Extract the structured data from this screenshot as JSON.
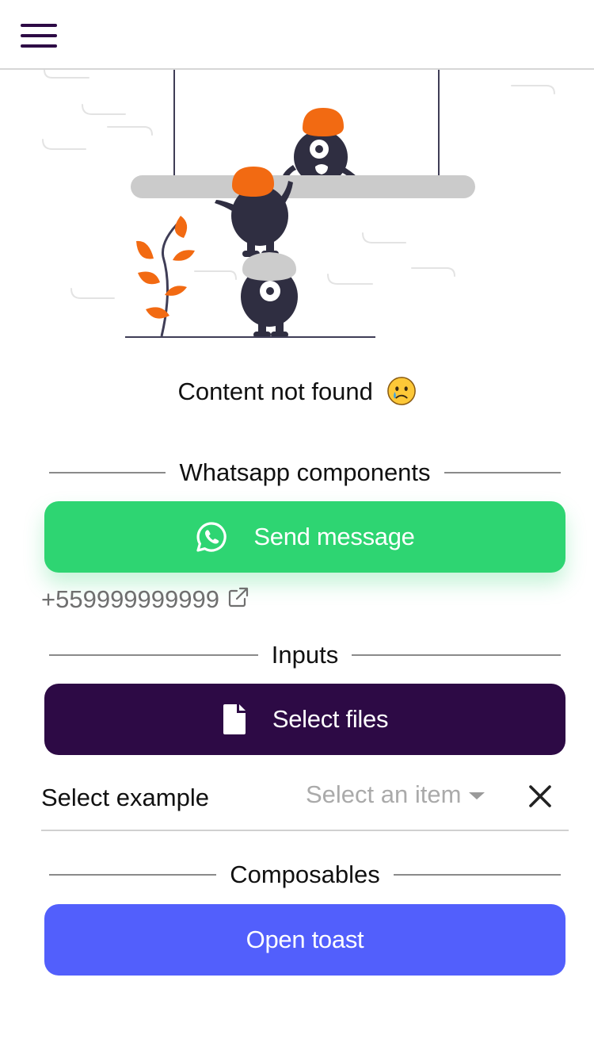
{
  "header": {
    "menu_icon": "hamburger-menu-icon",
    "accent": "#2d0a45"
  },
  "empty_state": {
    "text": "Content not found",
    "emoji": "crying-face-emoji"
  },
  "sections": {
    "whatsapp": "Whatsapp components",
    "inputs": "Inputs",
    "composables": "Composables"
  },
  "whatsapp": {
    "button_label": "Send message",
    "button_icon": "whatsapp-icon",
    "button_color": "#2ed572",
    "phone": "+559999999999",
    "phone_icon": "external-link-icon"
  },
  "inputs": {
    "files_button_label": "Select files",
    "files_button_icon": "file-icon",
    "files_button_color": "#2d0a45",
    "select_label": "Select example",
    "select_placeholder": "Select an item",
    "clear_icon": "close-icon"
  },
  "composables": {
    "toast_button_label": "Open toast",
    "toast_button_color": "#525ffc"
  }
}
